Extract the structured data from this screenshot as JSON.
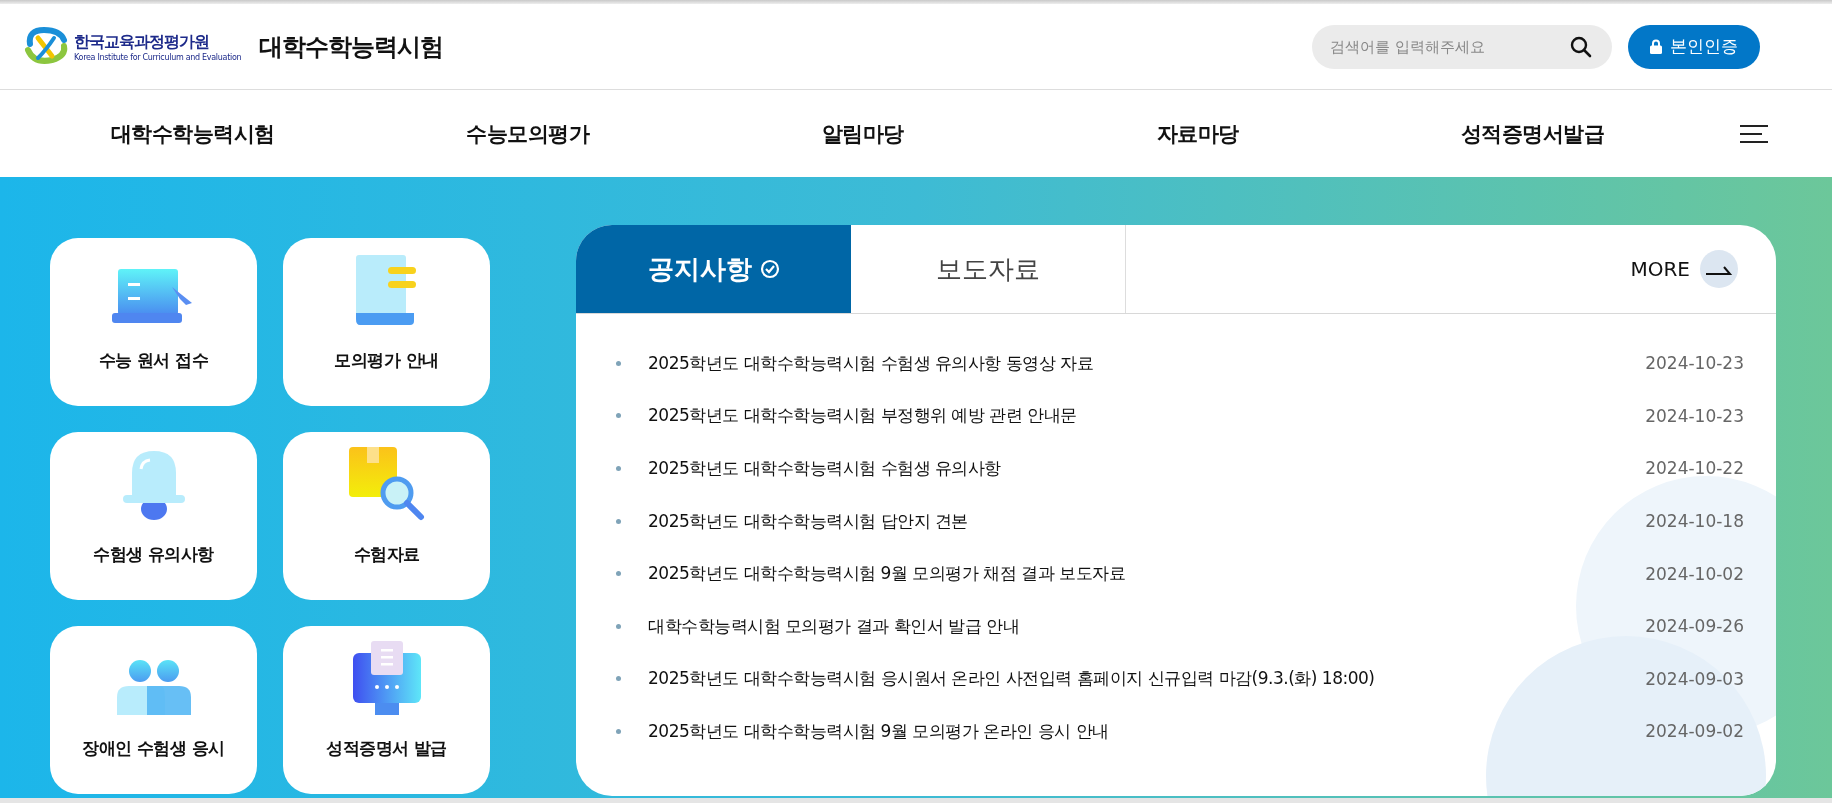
{
  "header": {
    "logo": {
      "name": "한국교육과정평가원",
      "subtitle": "Korea Institute for Curriculum and Evaluation"
    },
    "site_title": "대학수학능력시험",
    "search": {
      "placeholder": "검색어를 입력해주세요"
    },
    "auth_button": "본인인증"
  },
  "nav": {
    "items": [
      "대학수학능력시험",
      "수능모의평가",
      "알림마당",
      "자료마당",
      "성적증명서발급"
    ]
  },
  "quick_links": [
    {
      "label": "수능 원서 접수",
      "kind": "laptop"
    },
    {
      "label": "모의평가 안내",
      "kind": "document"
    },
    {
      "label": "수험생 유의사항",
      "kind": "bell"
    },
    {
      "label": "수험자료",
      "kind": "search-box"
    },
    {
      "label": "장애인 수험생 응시",
      "kind": "people"
    },
    {
      "label": "성적증명서 발급",
      "kind": "kiosk"
    }
  ],
  "board": {
    "tabs": [
      {
        "label": "공지사항",
        "selected": true
      },
      {
        "label": "보도자료",
        "selected": false
      }
    ],
    "more": "MORE",
    "items": [
      {
        "title": "2025학년도 대학수학능력시험 수험생 유의사항 동영상 자료",
        "date": "2024-10-23"
      },
      {
        "title": "2025학년도 대학수학능력시험 부정행위 예방 관련 안내문",
        "date": "2024-10-23"
      },
      {
        "title": "2025학년도 대학수학능력시험 수험생 유의사항",
        "date": "2024-10-22"
      },
      {
        "title": "2025학년도 대학수학능력시험 답안지 견본",
        "date": "2024-10-18"
      },
      {
        "title": "2025학년도 대학수학능력시험 9월 모의평가 채점 결과 보도자료",
        "date": "2024-10-02"
      },
      {
        "title": "대학수학능력시험 모의평가 결과 확인서 발급 안내",
        "date": "2024-09-26"
      },
      {
        "title": "2025학년도 대학수학능력시험 응시원서 온라인 사전입력 홈페이지 신규입력 마감(9.3.(화) 18:00)",
        "date": "2024-09-03"
      },
      {
        "title": "2025학년도 대학수학능력시험 9월 모의평가 온라인 응시 안내",
        "date": "2024-09-02"
      }
    ]
  }
}
